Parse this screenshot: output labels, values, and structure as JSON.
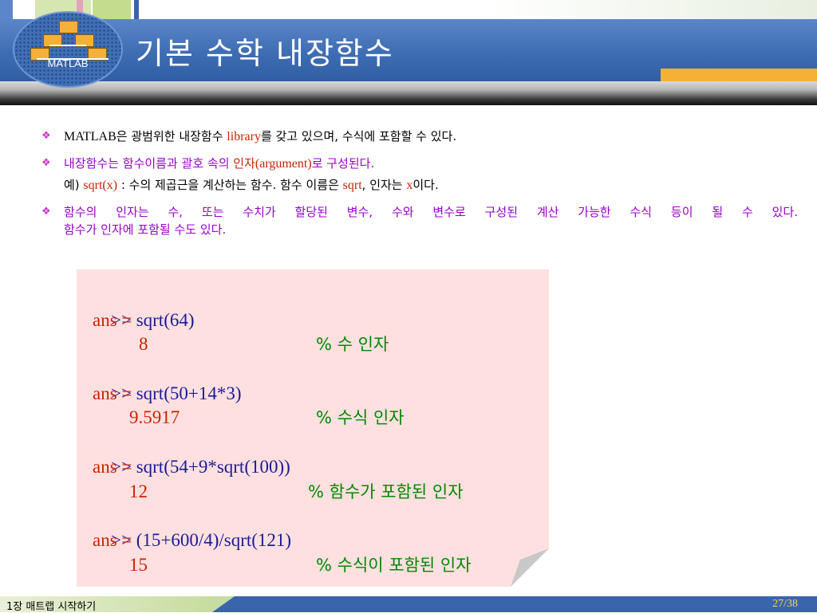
{
  "header": {
    "title": "기본 수학 내장함수",
    "logo_text": "MATLAB"
  },
  "bullets": {
    "b1": {
      "t1": "MATLAB",
      "t2": "은 광범위한 내장함수 ",
      "t3": "library",
      "t4": "를 갖고 있으며, 수식에 포함할 수 있다."
    },
    "b2": {
      "t1": "내장함수는 함수이름과 괄호 속의 ",
      "t2": "인자",
      "t3": "(argument)",
      "t4": "로 구성된다."
    },
    "b2b": {
      "t1": "예) ",
      "t2": "sqrt(x)",
      "t3": " : 수의 제곱근을 계산하는 함수. 함수 이름은 ",
      "t4": "sqrt",
      "t5": ", 인자는 ",
      "t6": "x",
      "t7": "이다."
    },
    "b3": {
      "line1": "함수의 인자는 수, 또는 수치가 할당된 변수, 수와 변수로 구성된 계산 가능한 수식 등이 될 수 있다.",
      "line2": "함수가 인자에 포함될 수도 있다."
    }
  },
  "code": {
    "r1": {
      "cmd": ">> sqrt(64)",
      "comment": "% 수 인자"
    },
    "r2": "ans =",
    "r3": "8",
    "r4": {
      "cmd": ">> sqrt(50+14*3)",
      "comment": "% 수식 인자"
    },
    "r5": "ans =",
    "r6": "9.5917",
    "r7": {
      "cmd": ">> sqrt(54+9*sqrt(100))",
      "comment": "% 함수가 포함된 인자"
    },
    "r8": "ans =",
    "r9": "12",
    "r10": {
      "cmd": ">> (15+600/4)/sqrt(121)",
      "comment": "% 수식이 포함된 인자"
    },
    "r11": "ans =",
    "r12": "15"
  },
  "footer": {
    "chapter": "1장  매트랩 시작하기",
    "page": "27/38"
  },
  "colors": {
    "header_blue": "#3e6db3",
    "accent_orange": "#f5b038",
    "bullet_magenta": "#cc33cc",
    "code_box_pink": "#ffe0e0",
    "comment_green": "#008800",
    "answer_red": "#cc2200"
  }
}
